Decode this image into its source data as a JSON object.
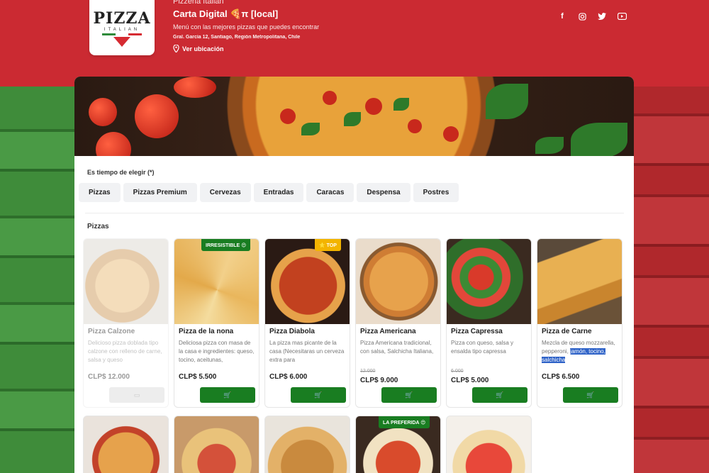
{
  "header": {
    "restaurant_name": "Pizzeria Italian",
    "title": "Carta Digital 🍕π [local]",
    "description": "Menú con las mejores pizzas que puedes encontrar",
    "address": "Gral. García 12, Santiago, Región Metropolitana, Chile",
    "location_link": "Ver ubicación",
    "logo_text": "PIZZA",
    "logo_sub": "ITALIAN",
    "socials": [
      "facebook-icon",
      "instagram-icon",
      "twitter-icon",
      "youtube-icon"
    ]
  },
  "colors": {
    "brand_red": "#cb2a32",
    "button_green": "#197d21",
    "badge_gold": "#f3b400"
  },
  "menu": {
    "prompt": "Es tiempo de elegir (*)",
    "tabs": [
      "Pizzas",
      "Pizzas Premium",
      "Cervezas",
      "Entradas",
      "Caracas",
      "Despensa",
      "Postres"
    ],
    "section_title": "Pizzas"
  },
  "products": [
    {
      "name": "Pizza Calzone",
      "desc": "Delicioso pizza doblada tipo calzone con relleno de carne, salsa y queso",
      "old_price": "",
      "price": "CLP$ 12.000",
      "badge": "",
      "available": false
    },
    {
      "name": "Pizza de la nona",
      "desc": "Deliciosa pizza con masa de la casa e ingredientes: queso, tocino, aceitunas,",
      "old_price": "",
      "price": "CLP$ 5.500",
      "badge": "IRRESISTIBLE 😍",
      "available": true
    },
    {
      "name": "Pizza Diabola",
      "desc": "La pizza mas picante de la casa (Necesitaras un cerveza extra para",
      "old_price": "",
      "price": "CLP$ 6.000",
      "badge": "⭐ TOP",
      "available": true
    },
    {
      "name": "Pizza Americana",
      "desc": "Pizza Americana tradicional, con salsa, Salchicha Italiana,",
      "old_price": "12.000",
      "price": "CLP$ 9.000",
      "badge": "",
      "available": true
    },
    {
      "name": "Pizza Capressa",
      "desc": "Pizza con queso, salsa y ensalda tipo capressa",
      "old_price": "6.000",
      "price": "CLP$ 5.000",
      "badge": "",
      "available": true
    },
    {
      "name": "Pizza de Carne",
      "desc_plain": "Mezcla de queso mozzarella, pepperoni,",
      "desc_highlight": "jamón, tocino, salchicha",
      "old_price": "",
      "price": "CLP$ 6.500",
      "badge": "",
      "available": true
    }
  ],
  "second_row_badges": [
    "",
    "",
    "",
    "LA PREFERIDA 😍",
    ""
  ]
}
